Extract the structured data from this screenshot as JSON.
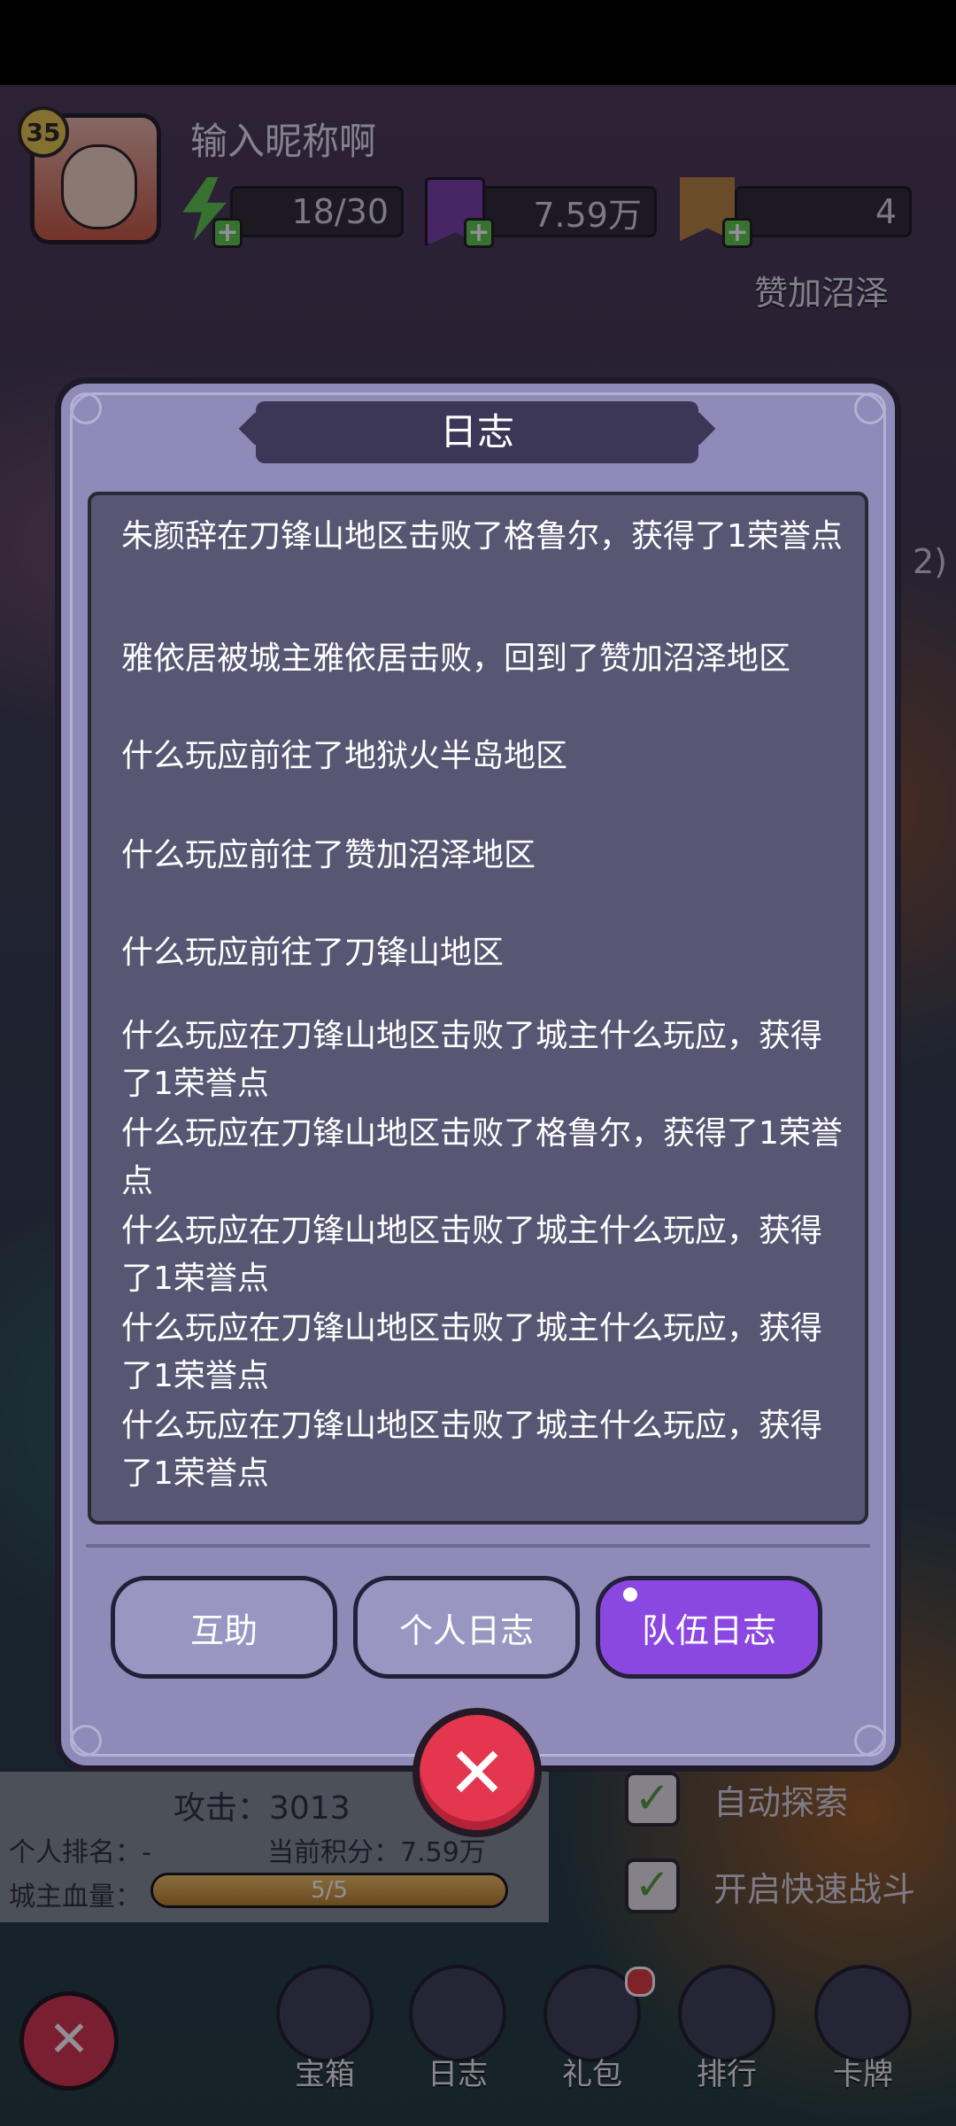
{
  "player": {
    "level": "35",
    "nickname": "输入昵称啊",
    "energy": "18/30",
    "honor": "7.59万",
    "flags": "4"
  },
  "region": "赞加沼泽",
  "side_text": "2)",
  "dialog": {
    "title": "日志",
    "entries": [
      "朱颜辞在刀锋山地区击败了格鲁尔，获得了1荣誉点",
      "雅依居被城主雅依居击败，回到了赞加沼泽地区",
      "什么玩应前往了地狱火半岛地区",
      "什么玩应前往了赞加沼泽地区",
      "什么玩应前往了刀锋山地区",
      "什么玩应在刀锋山地区击败了城主什么玩应，获得了1荣誉点",
      "什么玩应在刀锋山地区击败了格鲁尔，获得了1荣誉点",
      "什么玩应在刀锋山地区击败了城主什么玩应，获得了1荣誉点",
      "什么玩应在刀锋山地区击败了城主什么玩应，获得了1荣誉点",
      "什么玩应在刀锋山地区击败了城主什么玩应，获得了1荣誉点"
    ],
    "tabs": [
      "互助",
      "个人日志",
      "队伍日志"
    ],
    "active_tab": "队伍日志"
  },
  "stats": {
    "attack": "攻击：3013",
    "rank": "个人排名：-",
    "score": "当前积分：7.59万",
    "hp_label": "城主血量：",
    "hp_text": "5/5",
    "hp_fraction": 1.0
  },
  "toggles": {
    "auto_explore": "自动探索",
    "fast_battle": "开启快速战斗"
  },
  "nav": [
    "宝箱",
    "日志",
    "礼包",
    "排行",
    "卡牌"
  ],
  "colors": {
    "modal_bg": "#8f8ab7",
    "log_bg": "#585673",
    "active_tab": "#8b48e0",
    "close_red": "#e5364f"
  }
}
